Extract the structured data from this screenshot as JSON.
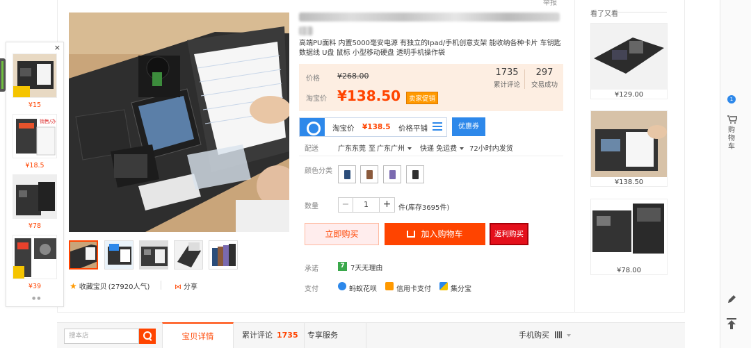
{
  "report_link": "举报",
  "subtitle": "高端PU面料 内置5000毫安电源 有独立的Ipad/手机创意支架 能收纳各种卡片 车钥匙 数据线 U盘 鼠标 小型移动硬盘 透明手机操作袋",
  "left_panel": {
    "close": "×",
    "items": [
      {
        "price": "¥15"
      },
      {
        "price": "¥18.5"
      },
      {
        "price": "¥78"
      },
      {
        "price": "¥39"
      }
    ],
    "dots": "●●"
  },
  "price": {
    "label": "价格",
    "original": "¥268.00",
    "taobao_label": "淘宝价",
    "current": "¥138.50",
    "promo_tag": "卖家促销"
  },
  "stats": {
    "reviews_count": "1735",
    "reviews_label": "累计评论",
    "deals_count": "297",
    "deals_label": "交易成功"
  },
  "protect": {
    "label": "淘宝价",
    "price": "¥138.5",
    "guard": "价格平铺",
    "coupon": "优惠券"
  },
  "shipping": {
    "label": "配送",
    "from": "广东东莞",
    "to_prefix": "至",
    "to": "广东广州",
    "express": "快递 免运费",
    "time": "72小时内发货"
  },
  "color": {
    "label": "颜色分类",
    "swatches": [
      "#2b4d7a",
      "#8b5a3c",
      "#7a6ab0",
      "#2f2f2f"
    ]
  },
  "quantity": {
    "label": "数量",
    "minus": "−",
    "value": "1",
    "plus": "+",
    "stock": "件(库存3695件)"
  },
  "buttons": {
    "buy_now": "立即购买",
    "add_cart": "加入购物车",
    "rebate": "返利购买"
  },
  "promise": {
    "label": "承诺",
    "icon": "7",
    "text": "7天无理由"
  },
  "payment": {
    "label": "支付",
    "methods": [
      "蚂蚁花呗",
      "信用卡支付",
      "集分宝"
    ]
  },
  "actions": {
    "collect": "收藏宝贝",
    "collect_count": "(27920人气)",
    "share": "分享"
  },
  "look_again": {
    "title": "看了又看",
    "items": [
      {
        "price": "¥129.00"
      },
      {
        "price": "¥138.50"
      },
      {
        "price": "¥78.00"
      }
    ]
  },
  "sidebar": {
    "cart_text": "购物车",
    "badge": "1"
  },
  "bottom": {
    "search_placeholder": "搜本店",
    "tab_detail": "宝贝详情",
    "tab_reviews": "累计评论",
    "tab_reviews_count": "1735",
    "tab_service": "专享服务",
    "tab_mobile": "手机购买"
  },
  "colors": {
    "accent": "#ff4400",
    "price_bg": "#fdeee2",
    "blue": "#2d88ea"
  }
}
